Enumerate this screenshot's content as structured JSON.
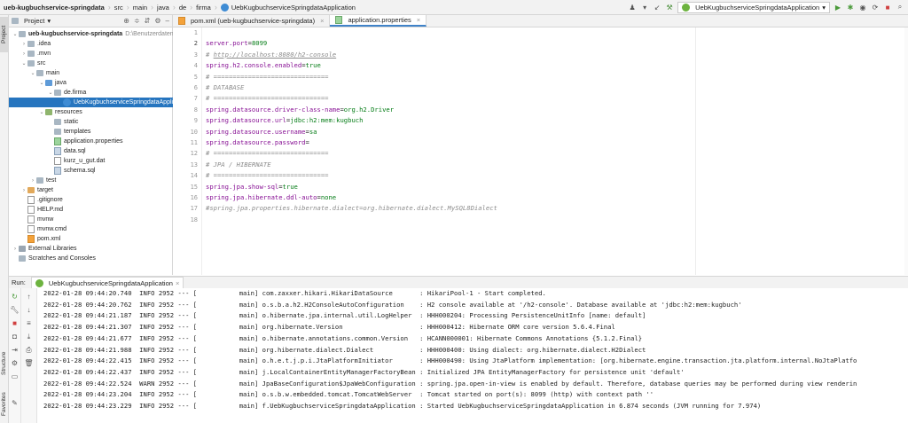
{
  "breadcrumbs": [
    "ueb-kugbuchservice-springdata",
    "src",
    "main",
    "java",
    "de",
    "firma",
    "UebKugbuchserviceSpringdataApplication"
  ],
  "run_config": "UebKugbuchserviceSpringdataApplication",
  "left_strip_tabs": [
    "Project",
    "Structure",
    "Favorites"
  ],
  "project_panel": {
    "title": "Project",
    "tree": [
      {
        "label": "ueb-kugbuchservice-springdata",
        "extra": "D:\\Benutzerdaten\\",
        "indent": 0,
        "arrow": "v",
        "icon": "folder",
        "bold": true
      },
      {
        "label": ".idea",
        "indent": 1,
        "arrow": ">",
        "icon": "folder"
      },
      {
        "label": ".mvn",
        "indent": 1,
        "arrow": ">",
        "icon": "folder"
      },
      {
        "label": "src",
        "indent": 1,
        "arrow": "v",
        "icon": "folder"
      },
      {
        "label": "main",
        "indent": 2,
        "arrow": "v",
        "icon": "folder"
      },
      {
        "label": "java",
        "indent": 3,
        "arrow": "v",
        "icon": "folder src"
      },
      {
        "label": "de.firma",
        "indent": 4,
        "arrow": "v",
        "icon": "folder"
      },
      {
        "label": "UebKugbuchserviceSpringdataApplic",
        "indent": 5,
        "arrow": "",
        "icon": "file java",
        "selected": true
      },
      {
        "label": "resources",
        "indent": 3,
        "arrow": "v",
        "icon": "folder res"
      },
      {
        "label": "static",
        "indent": 4,
        "arrow": "",
        "icon": "folder"
      },
      {
        "label": "templates",
        "indent": 4,
        "arrow": "",
        "icon": "folder"
      },
      {
        "label": "application.properties",
        "indent": 4,
        "arrow": "",
        "icon": "file prop"
      },
      {
        "label": "data.sql",
        "indent": 4,
        "arrow": "",
        "icon": "file sql"
      },
      {
        "label": "kurz_u_gut.dat",
        "indent": 4,
        "arrow": "",
        "icon": "file"
      },
      {
        "label": "schema.sql",
        "indent": 4,
        "arrow": "",
        "icon": "file sql"
      },
      {
        "label": "test",
        "indent": 2,
        "arrow": ">",
        "icon": "folder"
      },
      {
        "label": "target",
        "indent": 1,
        "arrow": ">",
        "icon": "folder tgt"
      },
      {
        "label": ".gitignore",
        "indent": 1,
        "arrow": "",
        "icon": "file"
      },
      {
        "label": "HELP.md",
        "indent": 1,
        "arrow": "",
        "icon": "file"
      },
      {
        "label": "mvnw",
        "indent": 1,
        "arrow": "",
        "icon": "file"
      },
      {
        "label": "mvnw.cmd",
        "indent": 1,
        "arrow": "",
        "icon": "file"
      },
      {
        "label": "pom.xml",
        "indent": 1,
        "arrow": "",
        "icon": "file xml"
      },
      {
        "label": "External Libraries",
        "indent": 0,
        "arrow": ">",
        "icon": "folder lib"
      },
      {
        "label": "Scratches and Consoles",
        "indent": 0,
        "arrow": "",
        "icon": "folder"
      }
    ]
  },
  "editor_tabs": [
    {
      "label": "pom.xml (ueb-kugbuchservice-springdata)",
      "icon": "file xml",
      "active": false
    },
    {
      "label": "application.properties",
      "icon": "file prop",
      "active": true
    }
  ],
  "editor_lines": [
    {
      "n": "1",
      "parts": []
    },
    {
      "n": "2",
      "parts": [
        {
          "t": "server.port",
          "c": "k"
        },
        {
          "t": "=",
          "c": ""
        },
        {
          "t": "8099",
          "c": "v"
        }
      ]
    },
    {
      "n": "3",
      "parts": [
        {
          "t": "# ",
          "c": "c"
        },
        {
          "t": "http://localhost:8080/h2-console",
          "c": "c u"
        }
      ]
    },
    {
      "n": "4",
      "parts": [
        {
          "t": "spring.h2.console.enabled",
          "c": "k"
        },
        {
          "t": "=",
          "c": ""
        },
        {
          "t": "true",
          "c": "v"
        }
      ]
    },
    {
      "n": "5",
      "parts": [
        {
          "t": "# ==============================",
          "c": "c"
        }
      ]
    },
    {
      "n": "6",
      "parts": [
        {
          "t": "# DATABASE",
          "c": "c"
        }
      ]
    },
    {
      "n": "7",
      "parts": [
        {
          "t": "# ==============================",
          "c": "c"
        }
      ]
    },
    {
      "n": "8",
      "parts": [
        {
          "t": "spring.datasource.driver-class-name",
          "c": "k"
        },
        {
          "t": "=",
          "c": ""
        },
        {
          "t": "org.h2.Driver",
          "c": "v"
        }
      ]
    },
    {
      "n": "9",
      "parts": [
        {
          "t": "spring.datasource.url",
          "c": "k"
        },
        {
          "t": "=",
          "c": ""
        },
        {
          "t": "jdbc:h2:mem:kugbuch",
          "c": "v"
        }
      ]
    },
    {
      "n": "10",
      "parts": [
        {
          "t": "spring.datasource.username",
          "c": "k"
        },
        {
          "t": "=",
          "c": ""
        },
        {
          "t": "sa",
          "c": "v"
        }
      ]
    },
    {
      "n": "11",
      "parts": [
        {
          "t": "spring.datasource.password",
          "c": "k"
        },
        {
          "t": "=",
          "c": ""
        }
      ]
    },
    {
      "n": "12",
      "parts": [
        {
          "t": "# ==============================",
          "c": "c"
        }
      ]
    },
    {
      "n": "13",
      "parts": [
        {
          "t": "# JPA / HIBERNATE",
          "c": "c"
        }
      ]
    },
    {
      "n": "14",
      "parts": [
        {
          "t": "# ==============================",
          "c": "c"
        }
      ]
    },
    {
      "n": "15",
      "parts": [
        {
          "t": "spring.jpa.show-sql",
          "c": "k"
        },
        {
          "t": "=",
          "c": ""
        },
        {
          "t": "true",
          "c": "v"
        }
      ]
    },
    {
      "n": "16",
      "parts": [
        {
          "t": "spring.jpa.hibernate.ddl-auto",
          "c": "k"
        },
        {
          "t": "=",
          "c": ""
        },
        {
          "t": "none",
          "c": "v"
        }
      ]
    },
    {
      "n": "17",
      "parts": [
        {
          "t": "#spring.jpa.properties.hibernate.dialect=org.hibernate.dialect.MySQL8Dialect",
          "c": "c"
        }
      ]
    },
    {
      "n": "18",
      "parts": []
    }
  ],
  "run_panel": {
    "label": "Run:",
    "tab": "UebKugbuchserviceSpringdataApplication",
    "log": [
      "2022-01-28 09:44:20.740  INFO 2952 --- [           main] com.zaxxer.hikari.HikariDataSource       : HikariPool-1 - Start completed.",
      "2022-01-28 09:44:20.762  INFO 2952 --- [           main] o.s.b.a.h2.H2ConsoleAutoConfiguration    : H2 console available at '/h2-console'. Database available at 'jdbc:h2:mem:kugbuch'",
      "2022-01-28 09:44:21.187  INFO 2952 --- [           main] o.hibernate.jpa.internal.util.LogHelper  : HHH000204: Processing PersistenceUnitInfo [name: default]",
      "2022-01-28 09:44:21.307  INFO 2952 --- [           main] org.hibernate.Version                    : HHH000412: Hibernate ORM core version 5.6.4.Final",
      "2022-01-28 09:44:21.677  INFO 2952 --- [           main] o.hibernate.annotations.common.Version   : HCANN000001: Hibernate Commons Annotations {5.1.2.Final}",
      "2022-01-28 09:44:21.988  INFO 2952 --- [           main] org.hibernate.dialect.Dialect            : HHH000400: Using dialect: org.hibernate.dialect.H2Dialect",
      "2022-01-28 09:44:22.415  INFO 2952 --- [           main] o.h.e.t.j.p.i.JtaPlatformInitiator       : HHH000490: Using JtaPlatform implementation: [org.hibernate.engine.transaction.jta.platform.internal.NoJtaPlatfo",
      "2022-01-28 09:44:22.437  INFO 2952 --- [           main] j.LocalContainerEntityManagerFactoryBean : Initialized JPA EntityManagerFactory for persistence unit 'default'",
      "2022-01-28 09:44:22.524  WARN 2952 --- [           main] JpaBaseConfiguration$JpaWebConfiguration : spring.jpa.open-in-view is enabled by default. Therefore, database queries may be performed during view renderin",
      "2022-01-28 09:44:23.204  INFO 2952 --- [           main] o.s.b.w.embedded.tomcat.TomcatWebServer  : Tomcat started on port(s): 8099 (http) with context path ''",
      "2022-01-28 09:44:23.229  INFO 2952 --- [           main] f.UebKugbuchserviceSpringdataApplication : Started UebKugbuchserviceSpringdataApplication in 6.874 seconds (JVM running for 7.974)"
    ]
  }
}
